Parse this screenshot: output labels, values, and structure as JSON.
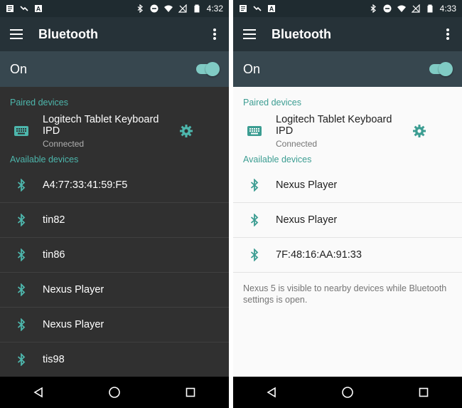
{
  "colors": {
    "accent": "#4db6ac",
    "toolbar": "#263238",
    "master_bar": "#37474f",
    "dark_bg": "#303030",
    "light_bg": "#fafafa"
  },
  "screens": [
    {
      "theme": "dark",
      "status": {
        "time": "4:32"
      },
      "toolbar": {
        "title": "Bluetooth"
      },
      "master": {
        "label": "On",
        "state": "on"
      },
      "paired_label": "Paired devices",
      "paired": {
        "name": "Logitech Tablet Keyboard IPD",
        "status": "Connected"
      },
      "available_label": "Available devices",
      "available": [
        "A4:77:33:41:59:F5",
        "tin82",
        "tin86",
        "Nexus Player",
        "Nexus Player",
        "tis98"
      ]
    },
    {
      "theme": "light",
      "status": {
        "time": "4:33"
      },
      "toolbar": {
        "title": "Bluetooth"
      },
      "master": {
        "label": "On",
        "state": "on"
      },
      "paired_label": "Paired devices",
      "paired": {
        "name": "Logitech Tablet Keyboard IPD",
        "status": "Connected"
      },
      "available_label": "Available devices",
      "available": [
        "Nexus Player",
        "Nexus Player",
        "7F:48:16:AA:91:33"
      ],
      "footer": "Nexus 5 is visible to nearby devices while Bluetooth settings is open."
    }
  ]
}
